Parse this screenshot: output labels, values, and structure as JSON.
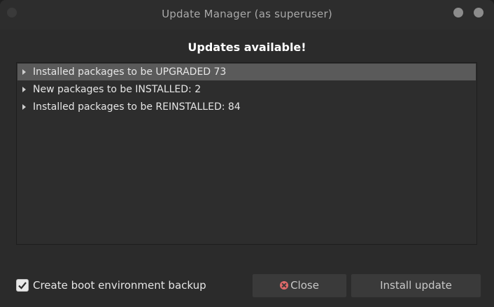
{
  "window": {
    "title": "Update Manager (as superuser)"
  },
  "main": {
    "heading": "Updates available!",
    "tree_items": [
      {
        "label": "Installed packages to be UPGRADED 73",
        "selected": true
      },
      {
        "label": "New packages to be INSTALLED: 2",
        "selected": false
      },
      {
        "label": "Installed packages to be REINSTALLED: 84",
        "selected": false
      }
    ]
  },
  "footer": {
    "backup_checkbox": {
      "label": "Create boot environment backup",
      "checked": true
    },
    "close_label": "Close",
    "install_label": "Install update"
  }
}
